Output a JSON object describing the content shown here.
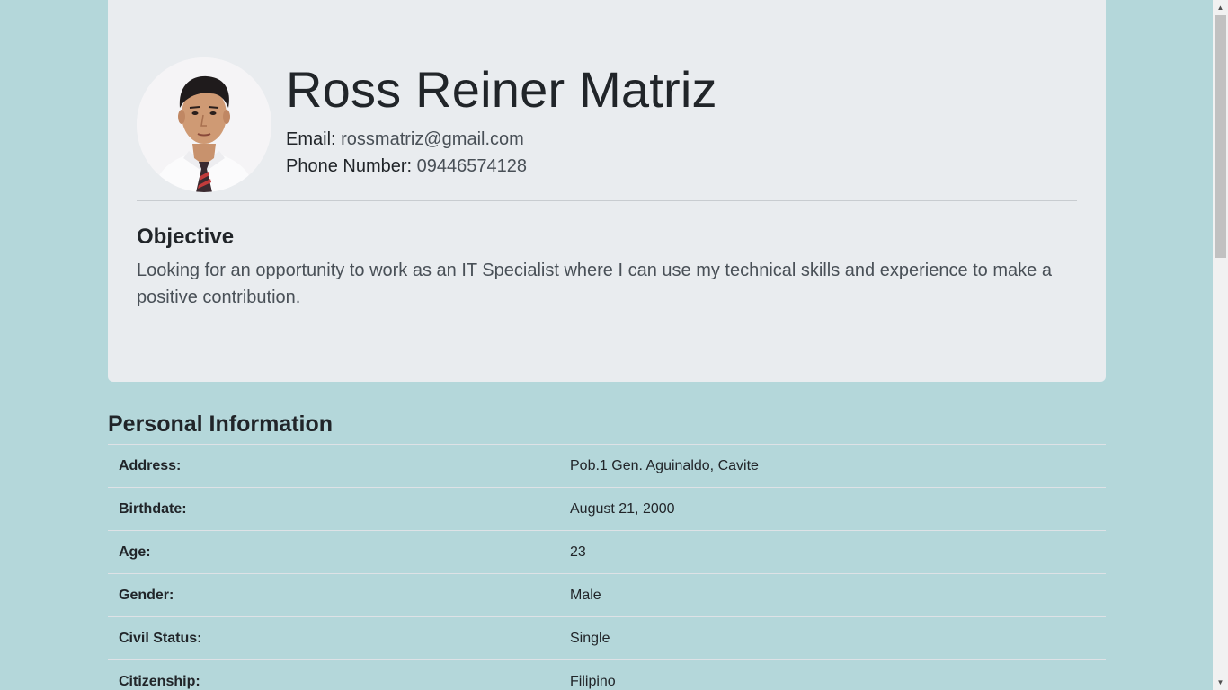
{
  "profile": {
    "name": "Ross Reiner Matriz",
    "email_label": "Email:",
    "email": "rossmatriz@gmail.com",
    "phone_label": "Phone Number:",
    "phone": "09446574128",
    "photo_icon": "profile-photo"
  },
  "objective": {
    "title": "Objective",
    "text": "Looking for an opportunity to work as an IT Specialist where I can use my technical skills and experience to make a positive contribution."
  },
  "personal_info": {
    "title": "Personal Information",
    "rows": [
      {
        "label": "Address:",
        "value": "Pob.1 Gen. Aguinaldo, Cavite"
      },
      {
        "label": "Birthdate:",
        "value": "August 21, 2000"
      },
      {
        "label": "Age:",
        "value": "23"
      },
      {
        "label": "Gender:",
        "value": "Male"
      },
      {
        "label": "Civil Status:",
        "value": "Single"
      },
      {
        "label": "Citizenship:",
        "value": "Filipino"
      }
    ]
  },
  "colors": {
    "page_background": "#b4d7da",
    "jumbotron_background": "#e9ecef",
    "text": "#212529"
  }
}
